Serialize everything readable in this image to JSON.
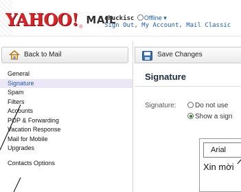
{
  "header": {
    "logo_yahoo": "YAHOO!",
    "logo_reg": "®",
    "logo_mail": "MAIL",
    "username": "chuckisc",
    "status": "Offline ▾",
    "links": "Sign Out, My Account, Mail Classic"
  },
  "sidebar": {
    "back_button": "Back to Mail",
    "items": [
      {
        "label": "General"
      },
      {
        "label": "Signature"
      },
      {
        "label": "Spam"
      },
      {
        "label": "Filters"
      },
      {
        "label": "Accounts"
      },
      {
        "label": "POP & Forwarding"
      },
      {
        "label": "Vacation Response"
      },
      {
        "label": "Mail for Mobile"
      },
      {
        "label": "Upgrades"
      },
      {
        "label": "Contacts Options"
      }
    ],
    "selected_index": 1
  },
  "main": {
    "save_button": "Save Changes",
    "title": "Signature",
    "signature_label": "Signature:",
    "radio_options": [
      {
        "label": "Do not use",
        "checked": false
      },
      {
        "label": "Show a sign",
        "checked": true
      }
    ],
    "font_select_value": "Arial",
    "editor_text": "Xin mời"
  },
  "colors": {
    "brand_red": "#d7262b",
    "link_blue": "#1e5aa8",
    "selected_bg": "#ece7f6"
  }
}
